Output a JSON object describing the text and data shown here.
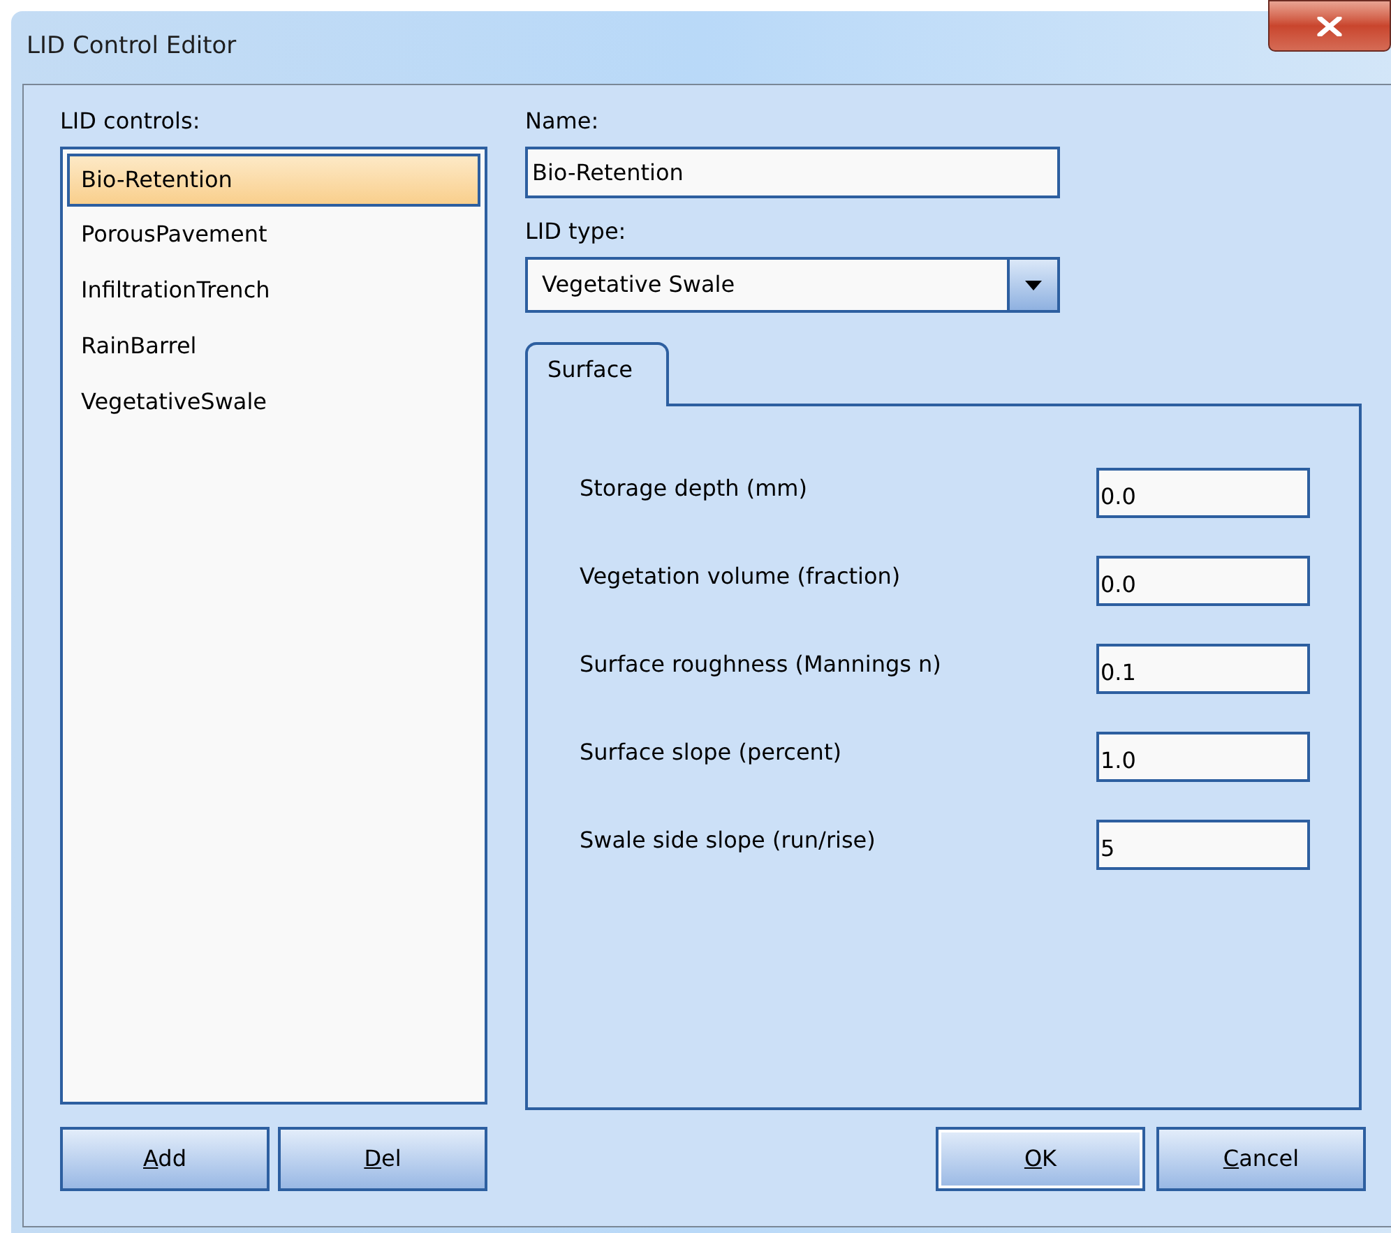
{
  "window": {
    "title": "LID Control Editor"
  },
  "lid_controls": {
    "label": "LID controls:",
    "items": [
      {
        "label": "Bio-Retention",
        "selected": true
      },
      {
        "label": "PorousPavement",
        "selected": false
      },
      {
        "label": "InfiltrationTrench",
        "selected": false
      },
      {
        "label": "RainBarrel",
        "selected": false
      },
      {
        "label": "VegetativeSwale",
        "selected": false
      }
    ]
  },
  "name": {
    "label": "Name:",
    "value": "Bio-Retention"
  },
  "lid_type": {
    "label": "LID type:",
    "value": "Vegetative Swale"
  },
  "tabs": [
    {
      "label": "Surface",
      "selected": true
    }
  ],
  "parameters": [
    {
      "label": "Storage depth (mm)",
      "value": "0.0"
    },
    {
      "label": "Vegetation volume (fraction)",
      "value": "0.0"
    },
    {
      "label": "Surface roughness (Mannings n)",
      "value": "0.1"
    },
    {
      "label": "Surface slope (percent)",
      "value": "1.0"
    },
    {
      "label": "Swale side slope (run/rise)",
      "value": "5"
    }
  ],
  "list_buttons": [
    {
      "label": "Add",
      "default": false
    },
    {
      "label": "Del",
      "default": false
    }
  ],
  "dialog_buttons": [
    {
      "label": "OK",
      "default": true
    },
    {
      "label": "Cancel",
      "default": false
    }
  ]
}
